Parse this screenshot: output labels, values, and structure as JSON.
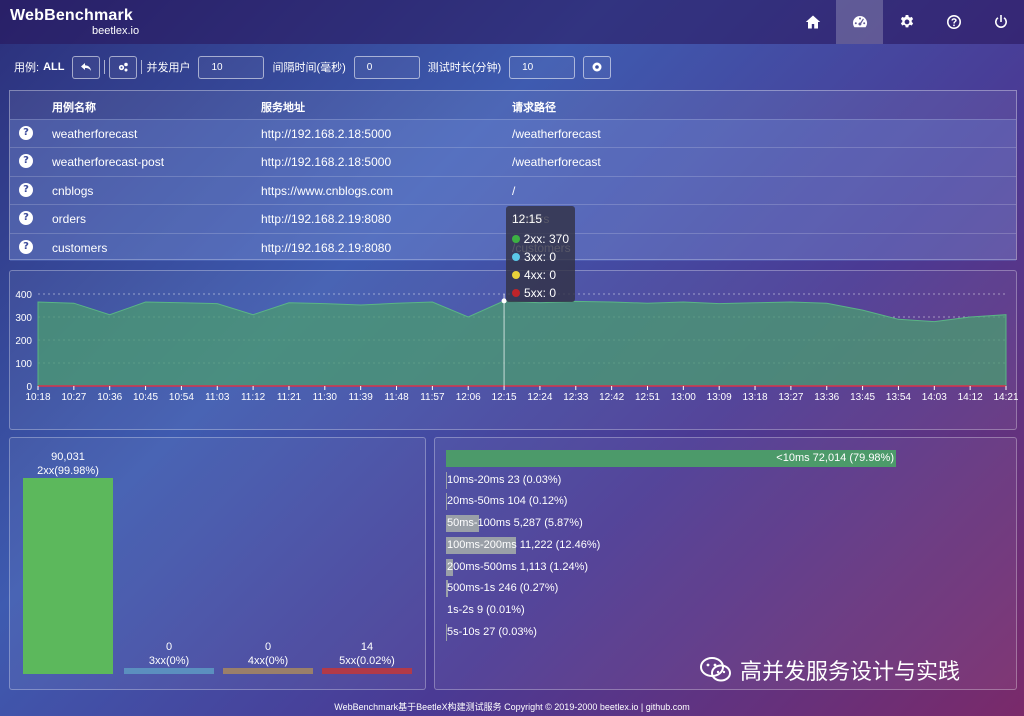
{
  "app": {
    "title": "WebBenchmark",
    "subtitle": "beetlex.io"
  },
  "nav": [
    "home-icon",
    "dashboard-icon",
    "gear-icon",
    "question-icon",
    "power-icon"
  ],
  "toolbar": {
    "case_label": "用例:",
    "case_value": "ALL",
    "users_label": "并发用户",
    "users_value": "10",
    "interval_label": "间隔时间(毫秒)",
    "interval_value": "0",
    "duration_label": "测试时长(分钟)",
    "duration_value": "10"
  },
  "table": {
    "headers": [
      "用例名称",
      "服务地址",
      "请求路径"
    ],
    "rows": [
      [
        "weatherforecast",
        "http://192.168.2.18:5000",
        "/weatherforecast"
      ],
      [
        "weatherforecast-post",
        "http://192.168.2.18:5000",
        "/weatherforecast"
      ],
      [
        "cnblogs",
        "https://www.cnblogs.com",
        "/"
      ],
      [
        "orders",
        "http://192.168.2.19:8080",
        "/orders"
      ],
      [
        "customers",
        "http://192.168.2.19:8080",
        "/customers"
      ]
    ]
  },
  "tooltip": {
    "time": "12:15",
    "items": [
      {
        "label": "2xx: 370",
        "color": "#3cb043"
      },
      {
        "label": "3xx: 0",
        "color": "#5bc8e8"
      },
      {
        "label": "4xx: 0",
        "color": "#e8d23a"
      },
      {
        "label": "5xx: 0",
        "color": "#c0242a"
      }
    ]
  },
  "chart_data": [
    {
      "type": "area",
      "ylim": [
        0,
        400
      ],
      "yticks": [
        0,
        100,
        200,
        300,
        400
      ],
      "x": [
        "10:18",
        "10:27",
        "10:36",
        "10:45",
        "10:54",
        "11:03",
        "11:12",
        "11:21",
        "11:30",
        "11:39",
        "11:48",
        "11:57",
        "12:06",
        "12:15",
        "12:24",
        "12:33",
        "12:42",
        "12:51",
        "13:00",
        "13:09",
        "13:18",
        "13:27",
        "13:36",
        "13:45",
        "13:54",
        "14:03",
        "14:12",
        "14:21"
      ],
      "series": [
        {
          "values": [
            365,
            360,
            310,
            365,
            362,
            358,
            310,
            362,
            358,
            352,
            360,
            365,
            300,
            370,
            362,
            368,
            365,
            360,
            365,
            358,
            362,
            365,
            360,
            330,
            290,
            280,
            300,
            310
          ],
          "color": "#4a9a72"
        }
      ],
      "grid": true
    },
    {
      "type": "bar",
      "categories": [
        "2xx(99.98%)",
        "3xx(0%)",
        "4xx(0%)",
        "5xx(0.02%)"
      ],
      "values": [
        90031,
        0,
        0,
        14
      ],
      "value_labels": [
        "90,031",
        "0",
        "0",
        "14"
      ],
      "colors": [
        "#5cb85c",
        "#5b8fbf",
        "#9a7f6a",
        "#b23a48"
      ]
    },
    {
      "type": "bar",
      "orientation": "horizontal",
      "categories": [
        "<10ms",
        "10ms-20ms",
        "20ms-50ms",
        "50ms-100ms",
        "100ms-200ms",
        "200ms-500ms",
        "500ms-1s",
        "1s-2s",
        "5s-10s"
      ],
      "values": [
        72014,
        23,
        104,
        5287,
        11222,
        1113,
        246,
        9,
        27
      ],
      "percents": [
        79.98,
        0.03,
        0.12,
        5.87,
        12.46,
        1.24,
        0.27,
        0.01,
        0.03
      ],
      "labels": [
        "<10ms 72,014 (79.98%)",
        "10ms-20ms 23 (0.03%)",
        "20ms-50ms 104 (0.12%)",
        "50ms-100ms 5,287 (5.87%)",
        "100ms-200ms 11,222 (12.46%)",
        "200ms-500ms 1,113 (1.24%)",
        "500ms-1s 246 (0.27%)",
        "1s-2s 9 (0.01%)",
        "5s-10s 27 (0.03%)"
      ],
      "colors": [
        "#4c9a6a",
        "#9aa0a8",
        "#9aa0a8",
        "#9aa0a8",
        "#9aa0a8",
        "#9aa0a8",
        "#9aa0a8",
        "#9aa0a8",
        "#9aa0a8"
      ]
    }
  ],
  "footer": "WebBenchmark基于BeetleX构建测试服务 Copyright © 2019-2000 beetlex.io | github.com",
  "watermark": "高并发服务设计与实践"
}
